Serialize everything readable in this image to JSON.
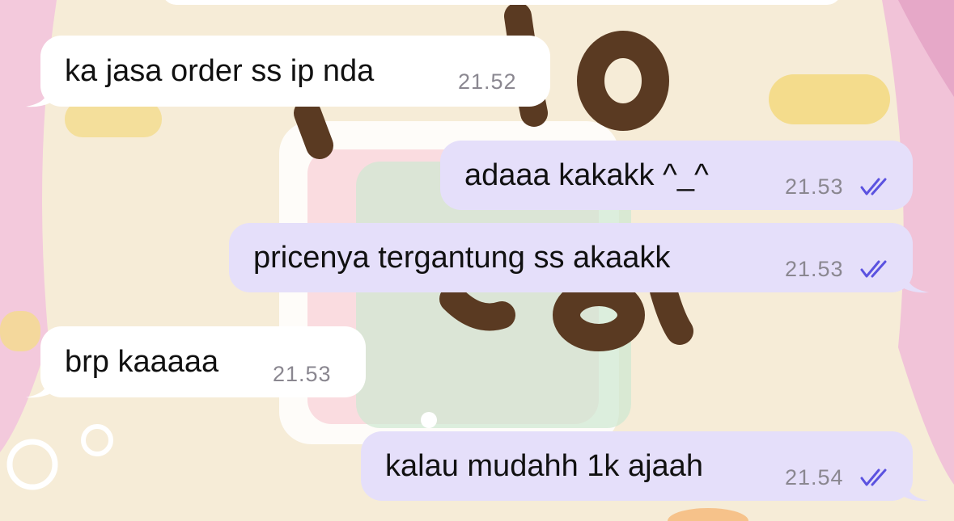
{
  "chat": {
    "messages": [
      {
        "direction": "incoming",
        "text": "ka jasa order ss ip nda",
        "time": "21.52"
      },
      {
        "direction": "outgoing",
        "text": "adaaa kakakk ^_^",
        "time": "21.53",
        "status": "read-double-check-icon"
      },
      {
        "direction": "outgoing",
        "text": "pricenya tergantung ss akaakk",
        "time": "21.53",
        "status": "read-double-check-icon"
      },
      {
        "direction": "incoming",
        "text": "brp kaaaaa",
        "time": "21.53"
      },
      {
        "direction": "outgoing",
        "text": "kalau mudahh 1k ajaah",
        "time": "21.54",
        "status": "read-double-check-icon"
      }
    ]
  },
  "colors": {
    "incoming_bubble": "#ffffff",
    "outgoing_bubble": "#e5dffa",
    "read_ticks": "#5b52e0",
    "wallpaper_base": "#f6ecd7"
  }
}
